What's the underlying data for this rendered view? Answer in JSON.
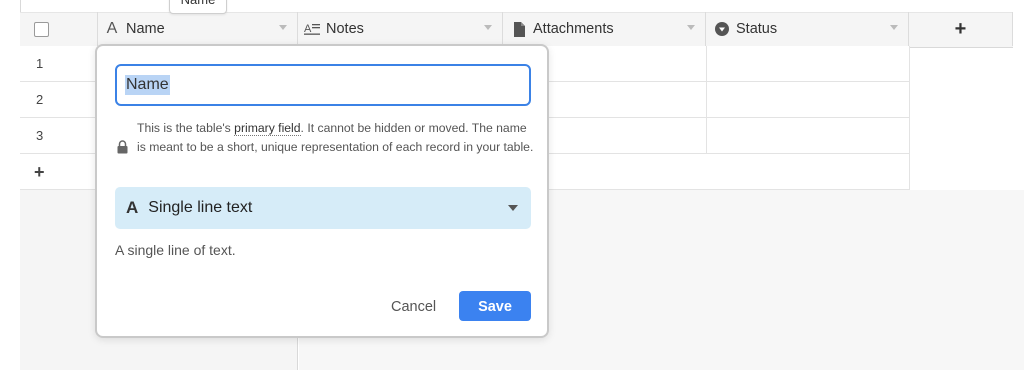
{
  "tooltip": {
    "text": "Name"
  },
  "header": {
    "columns": [
      {
        "label": "Name",
        "icon": "a-text-icon"
      },
      {
        "label": "Notes",
        "icon": "long-text-icon"
      },
      {
        "label": "Attachments",
        "icon": "file-icon"
      },
      {
        "label": "Status",
        "icon": "single-select-icon"
      }
    ],
    "add_column": "+"
  },
  "rows": [
    {
      "number": "1"
    },
    {
      "number": "2"
    },
    {
      "number": "3"
    }
  ],
  "add_row": "+",
  "popup": {
    "field_name": "Name",
    "info_line1_pre": "This is the table's ",
    "info_link": "primary field",
    "info_line1_post": ". It cannot be hidden or moved.",
    "info_line2": "The name is meant to be a short, unique representation of each record in your table.",
    "field_type": "Single line text",
    "field_type_icon": "A",
    "description": "A single line of text.",
    "cancel_label": "Cancel",
    "save_label": "Save"
  },
  "colors": {
    "accent": "#3b82f0",
    "select_bg": "#d6ecf8",
    "header_bg": "#f5f5f5"
  }
}
